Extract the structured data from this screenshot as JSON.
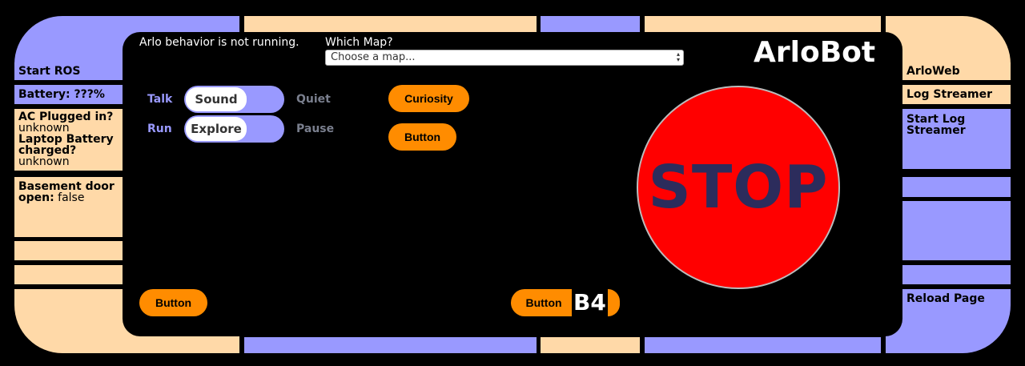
{
  "left_panel": {
    "start_ros": "Start ROS",
    "battery": "Battery: ???%",
    "ac_plugged_label": "AC Plugged in?",
    "ac_plugged_value": "unknown",
    "laptop_charged_label": "Laptop Battery charged?",
    "laptop_charged_value": "unknown",
    "basement_label": "Basement door open:",
    "basement_value": "false"
  },
  "right_panel": {
    "arloweb": "ArloWeb",
    "log_streamer": "Log Streamer",
    "start_log_streamer": "Start Log Streamer",
    "reload_page": "Reload Page"
  },
  "header": {
    "status": "Arlo behavior is not running.",
    "map_label": "Which Map?",
    "map_select_value": "Choose a map...",
    "title": "ArloBot"
  },
  "controls": {
    "talk_label": "Talk",
    "sound_label": "Sound",
    "quiet_label": "Quiet",
    "run_label": "Run",
    "explore_label": "Explore",
    "pause_label": "Pause",
    "curiosity_button": "Curiosity",
    "button2": "Button",
    "bottom_left_button": "Button",
    "bottom_button": "Button",
    "b4_label": "B4"
  },
  "stop": {
    "label": "STOP"
  },
  "colors": {
    "peach": "#ffd9a8",
    "lavender": "#9999ff",
    "orange": "#ff8c00",
    "stop_red": "#ff0000",
    "stop_text": "#2c2c5c"
  }
}
